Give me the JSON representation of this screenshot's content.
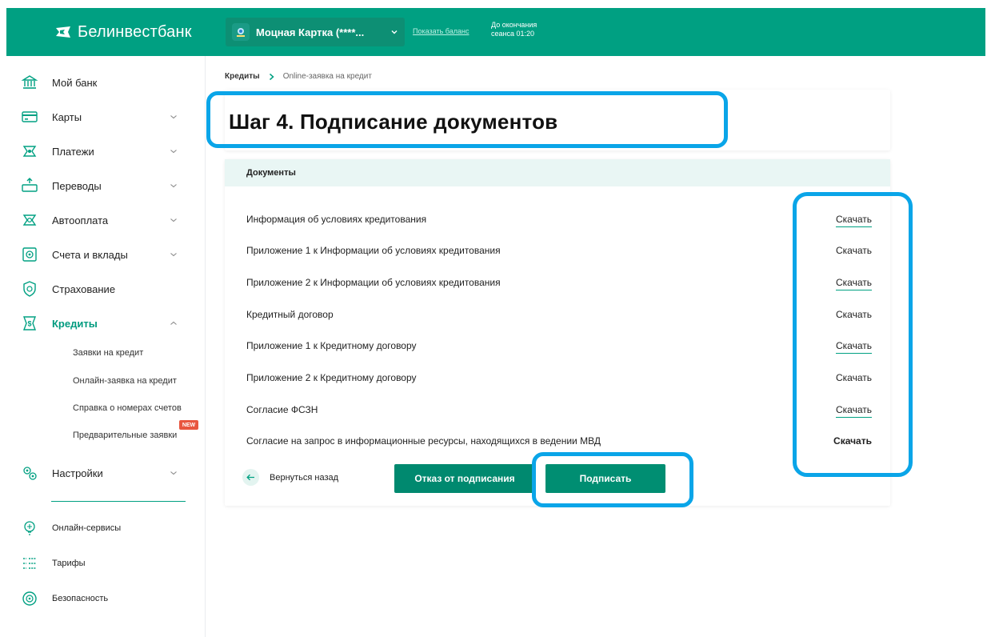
{
  "header": {
    "brand": "Белинвестбанк",
    "card_name": "Моцная Картка (****...",
    "show_balance": "Показать баланс",
    "session_line1": "До окончания",
    "session_line2": "сеанса 01:20",
    "colors": {
      "primary": "#00a082",
      "accent": "#0aa5e8"
    }
  },
  "sidebar": {
    "items": [
      {
        "label": "Мой банк",
        "icon": "bank-icon"
      },
      {
        "label": "Карты",
        "icon": "card-icon"
      },
      {
        "label": "Платежи",
        "icon": "payments-icon"
      },
      {
        "label": "Переводы",
        "icon": "transfers-icon"
      },
      {
        "label": "Автооплата",
        "icon": "autopay-icon"
      },
      {
        "label": "Счета и вклады",
        "icon": "accounts-icon"
      },
      {
        "label": "Страхование",
        "icon": "insurance-icon"
      },
      {
        "label": "Кредиты",
        "icon": "credit-icon"
      }
    ],
    "credit_sub": [
      "Заявки на кредит",
      "Онлайн-заявка на кредит",
      "Справка о номерах счетов",
      "Предварительные заявки"
    ],
    "new_badge": "NEW",
    "settings": "Настройки",
    "bottom_items": [
      {
        "label": "Онлайн-сервисы",
        "icon": "online-services-icon"
      },
      {
        "label": "Тарифы",
        "icon": "tariffs-icon"
      },
      {
        "label": "Безопасность",
        "icon": "security-icon"
      }
    ]
  },
  "breadcrumb": {
    "root": "Кредиты",
    "current": "Online-заявка на кредит"
  },
  "page": {
    "title": "Шаг 4. Подписание документов",
    "documents_header": "Документы",
    "download_label": "Скачать",
    "documents": [
      "Информация об условиях кредитования",
      "Приложение 1 к Информации об условиях кредитования",
      "Приложение 2 к Информации об условиях кредитования",
      "Кредитный договор",
      "Приложение 1 к Кредитному договору",
      "Приложение 2 к Кредитному договору",
      "Согласие ФСЗН",
      "Согласие на запрос в информационные ресурсы, находящихся в ведении МВД"
    ],
    "back_label": "Вернуться назад",
    "refuse_label": "Отказ от подписания",
    "sign_label": "Подписать"
  }
}
